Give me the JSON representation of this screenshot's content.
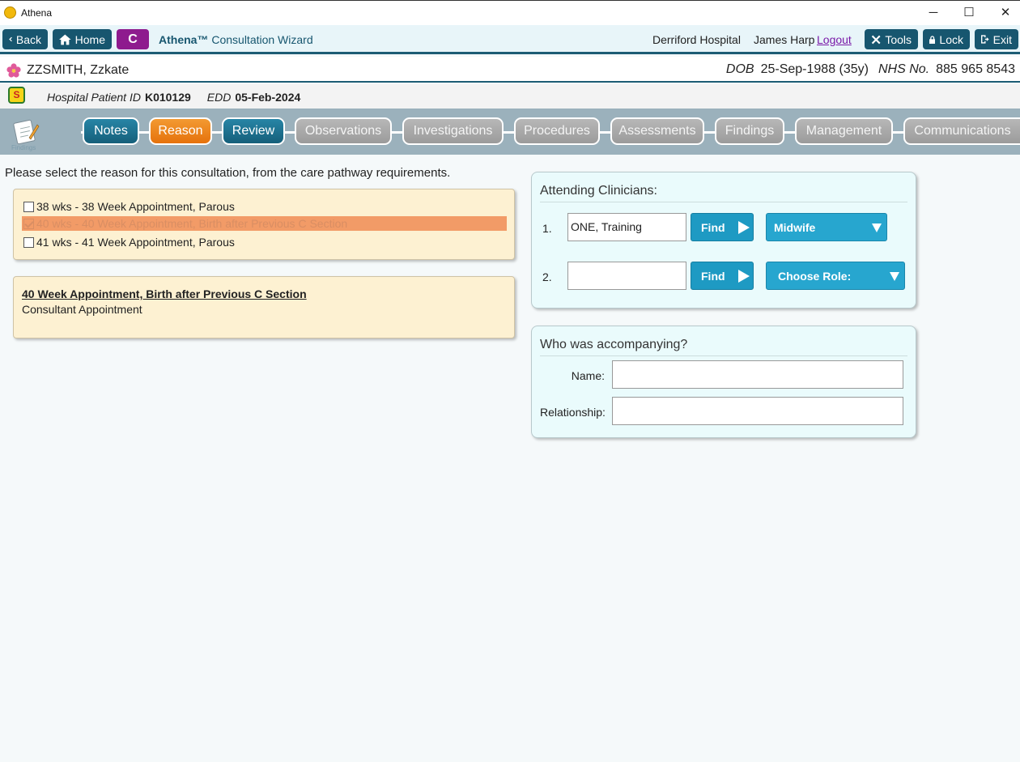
{
  "window": {
    "title": "Athena",
    "minimize": "─",
    "maximize": "☐",
    "close": "✕"
  },
  "toolbar": {
    "back_label": "Back",
    "home_label": "Home",
    "c_label": "C",
    "wizard_brand": "Athena™",
    "wizard_title": "Consultation Wizard",
    "hospital": "Derriford Hospital",
    "user": "James Harp",
    "logout": "Logout",
    "tools_label": "Tools",
    "lock_label": "Lock",
    "exit_label": "Exit"
  },
  "patient": {
    "name": "ZZSMITH, Zzkate",
    "dob_label": "DOB",
    "dob": "25-Sep-1988 (35y)",
    "nhs_label": "NHS No.",
    "nhs": "885 965 8543",
    "hpid_label": "Hospital Patient ID",
    "hpid": "K010129",
    "edd_label": "EDD",
    "edd": "05-Feb-2024"
  },
  "sidebar": {
    "findings_label": "Findings"
  },
  "tabs": [
    {
      "label": "Notes",
      "state": "done"
    },
    {
      "label": "Reason",
      "state": "active"
    },
    {
      "label": "Review",
      "state": "done"
    },
    {
      "label": "Observations",
      "state": "pending"
    },
    {
      "label": "Investigations",
      "state": "pending"
    },
    {
      "label": "Procedures",
      "state": "pending"
    },
    {
      "label": "Assessments",
      "state": "pending"
    },
    {
      "label": "Findings",
      "state": "pending"
    },
    {
      "label": "Management",
      "state": "pending"
    },
    {
      "label": "Communications",
      "state": "pending"
    }
  ],
  "main": {
    "prompt": "Please select the reason for this consultation, from the care pathway requirements.",
    "reasons": [
      {
        "label": "38 wks - 38 Week Appointment, Parous",
        "checked": false
      },
      {
        "label": "40 wks - 40 Week Appointment, Birth after Previous C Section",
        "checked": true
      },
      {
        "label": "41 wks - 41 Week Appointment, Parous",
        "checked": false
      }
    ],
    "detail": {
      "title": "40 Week Appointment, Birth after Previous C Section",
      "subtitle": "Consultant Appointment"
    }
  },
  "clinicians": {
    "title": "Attending Clinicians:",
    "rows": [
      {
        "num": "1.",
        "value": "ONE, Training",
        "find": "Find",
        "role": "Midwife"
      },
      {
        "num": "2.",
        "value": "",
        "find": "Find",
        "role": "Choose Role:"
      }
    ]
  },
  "accompany": {
    "title": "Who was accompanying?",
    "name_label": "Name:",
    "name_value": "",
    "relationship_label": "Relationship:",
    "relationship_value": ""
  },
  "colors": {
    "teal": "#17566f",
    "accent_orange": "#ee8520",
    "selection": "#f29b67",
    "panel_yellow": "#fdf1d2",
    "panel_blue": "#eafbfc"
  }
}
